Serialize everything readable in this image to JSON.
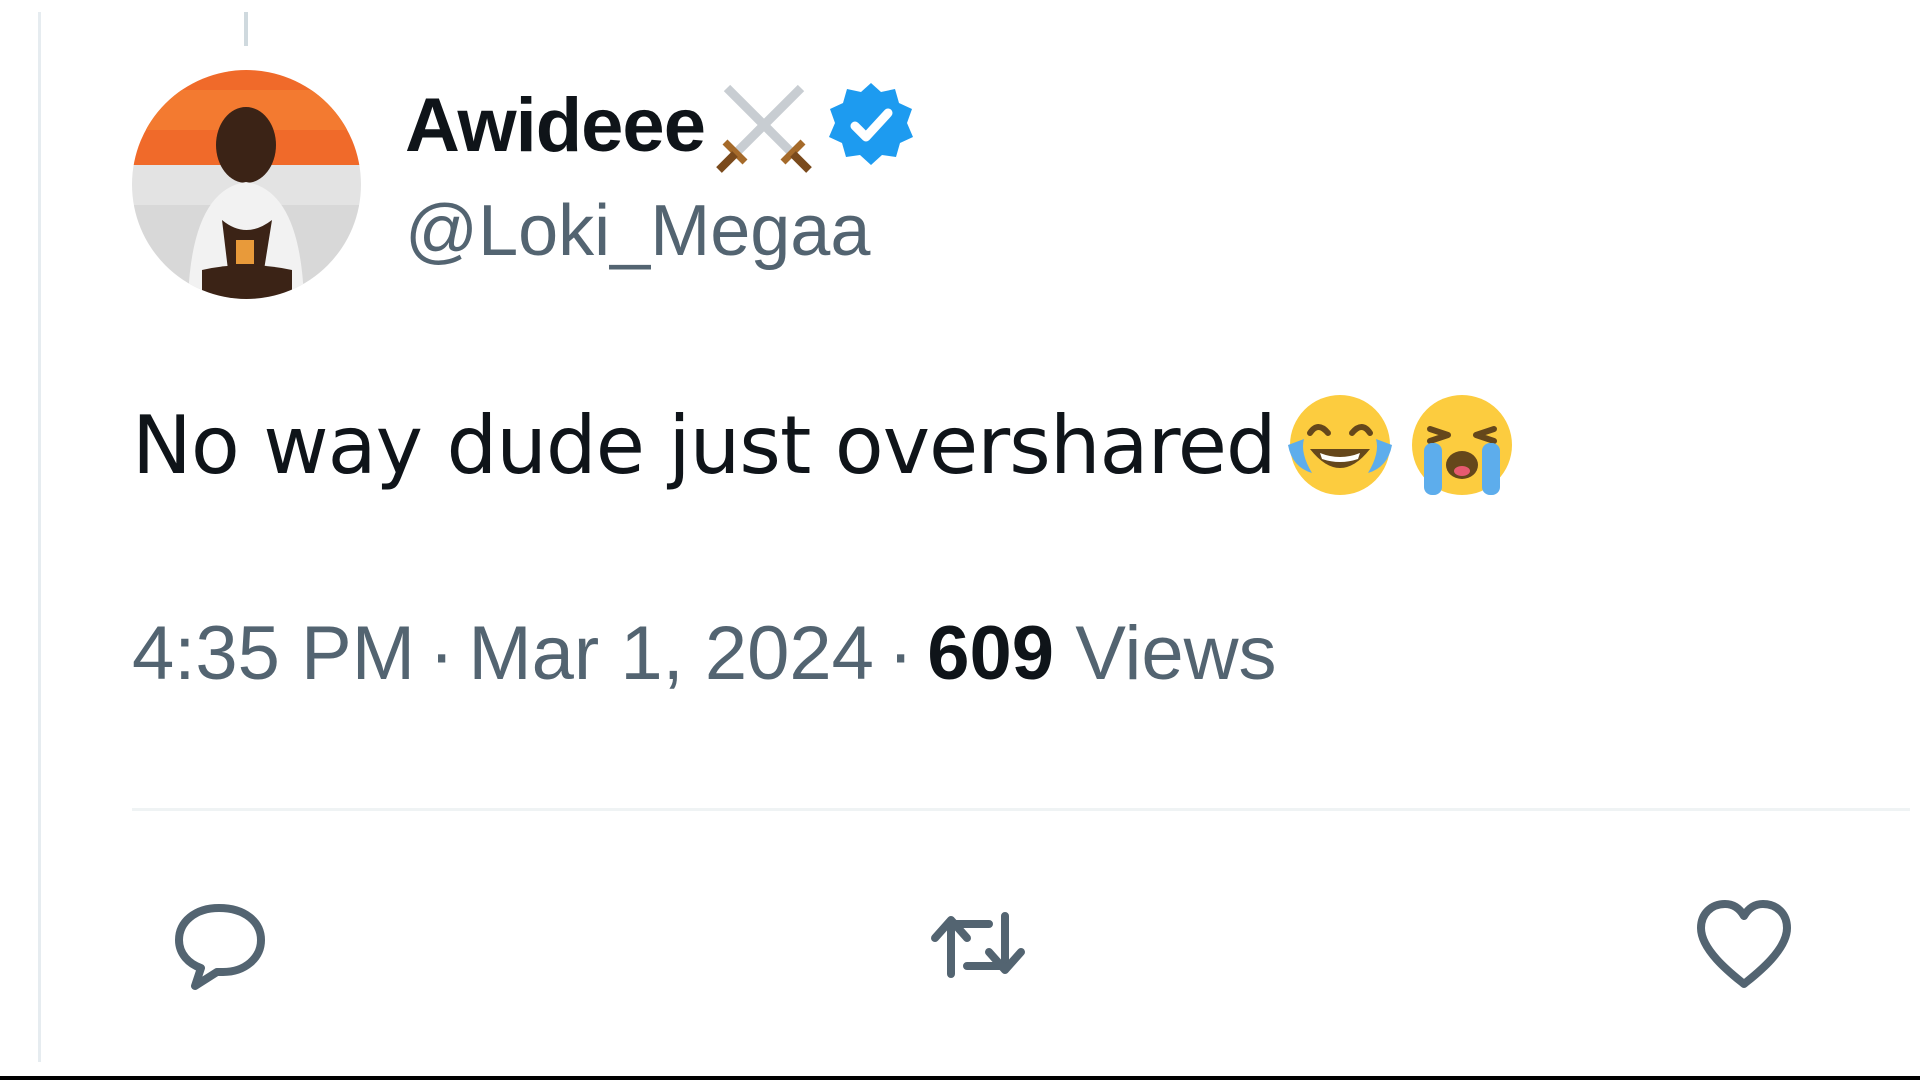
{
  "tweet": {
    "author": {
      "display_name": "Awideee",
      "name_emoji": "crossed-swords",
      "verified": true,
      "handle": "@Loki_Megaa",
      "avatar": "profile-photo"
    },
    "text": "No way dude just overshared",
    "text_emojis": [
      "face-with-tears-of-joy",
      "loudly-crying-face"
    ],
    "time": "4:35 PM",
    "date": "Mar 1, 2024",
    "separator": "·",
    "views_count": "609",
    "views_label": "Views",
    "actions": [
      "reply",
      "retweet",
      "like"
    ]
  },
  "colors": {
    "primary_text": "#0f1419",
    "secondary_text": "#536471",
    "verified_blue": "#1d9bf0",
    "divider": "#eff3f4"
  }
}
